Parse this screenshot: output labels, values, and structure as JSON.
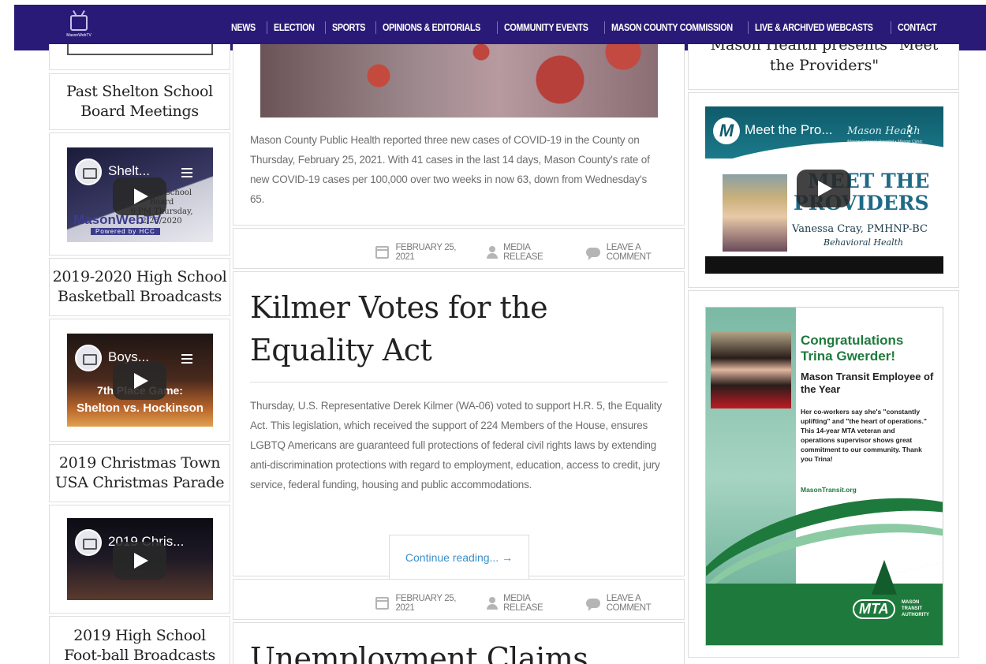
{
  "nav": {
    "logo_text": "MasonWebTV",
    "items": [
      "NEWS",
      "ELECTION",
      "SPORTS",
      "OPINIONS & EDITORIALS",
      "COMMUNITY EVENTS",
      "MASON COUNTY COMMISSION",
      "LIVE & ARCHIVED WEBCASTS",
      "CONTACT"
    ]
  },
  "sidebar_left": {
    "sections": [
      {
        "title": "Past Shelton School Board Meetings",
        "video_title": "Shelt...",
        "video_overlay": [
          "Shelton School Board",
          "6 PM Thursday, 2/25/2020"
        ],
        "video_brand": "MasonWebTV",
        "video_brand_sub": "Powered by HCC"
      },
      {
        "title": "2019-2020 High School Basketball Broadcasts",
        "video_title": "Boys...",
        "video_overlay": [
          "7th Place Game:",
          "Shelton vs. Hockinson"
        ]
      },
      {
        "title": "2019 Christmas Town USA Christmas Parade",
        "video_title": "2019 Chris..."
      },
      {
        "title": "2019 High School Foot-ball Broadcasts"
      }
    ]
  },
  "main": {
    "post1": {
      "excerpt": "Mason County Public Health reported three new cases of COVID-19 in the County on Thursday, February 25, 2021. With 41 cases in the last 14 days, Mason County's rate of new COVID-19 cases per 100,000 over two weeks in now 63, down from Wednesday's 65.",
      "date": "FEBRUARY 25, 2021",
      "author": "MEDIA RELEASE",
      "comment": "LEAVE A COMMENT"
    },
    "post2": {
      "title_line1": "Kilmer Votes for the",
      "title_line2": "Equality Act",
      "excerpt": "Thursday, U.S. Representative Derek Kilmer (WA-06) voted to support H.R. 5, the Equality Act. This legislation, which received the support of 224 Members of the House, ensures LGBTQ Americans are guaranteed full protections of federal civil rights laws by extending anti-discrimination protections with regard to employment, education, access to credit, jury service, federal funding, housing and public accommodations.",
      "continue": "Continue reading... →",
      "date": "FEBRUARY 25, 2021",
      "author": "MEDIA RELEASE",
      "comment": "LEAVE A COMMENT"
    },
    "post3": {
      "title_partial": "Unemployment Claims"
    }
  },
  "sidebar_right": {
    "mason_health_title": "Mason Health presents \"Meet the Providers\"",
    "video": {
      "title": "Meet the Pro...",
      "brand": "Mason Health",
      "brand_sub": "Mason General Hospital • Mason Clinic",
      "headline_1": "MEET THE",
      "headline_2": "PROVIDERS",
      "provider_name": "Vanessa Cray, PMHNP-BC",
      "provider_role": "Behavioral Health"
    },
    "mta_ad": {
      "headline": "Congratulations Trina Gwerder!",
      "subhead": "Mason Transit Employee of the Year",
      "body": "Her co-workers say she's \"constantly uplifting\" and \"the heart of operations.\" This 14-year MTA veteran and operations supervisor shows great commitment to our community. Thank you Trina!",
      "url": "MasonTransit.org",
      "logo": "MTA",
      "logo_sub": "MASON TRANSIT AUTHORITY"
    }
  },
  "colors": {
    "nav_bg": "#2a1a77",
    "link": "#3a8fc8",
    "mta_green": "#1e7a3c"
  }
}
